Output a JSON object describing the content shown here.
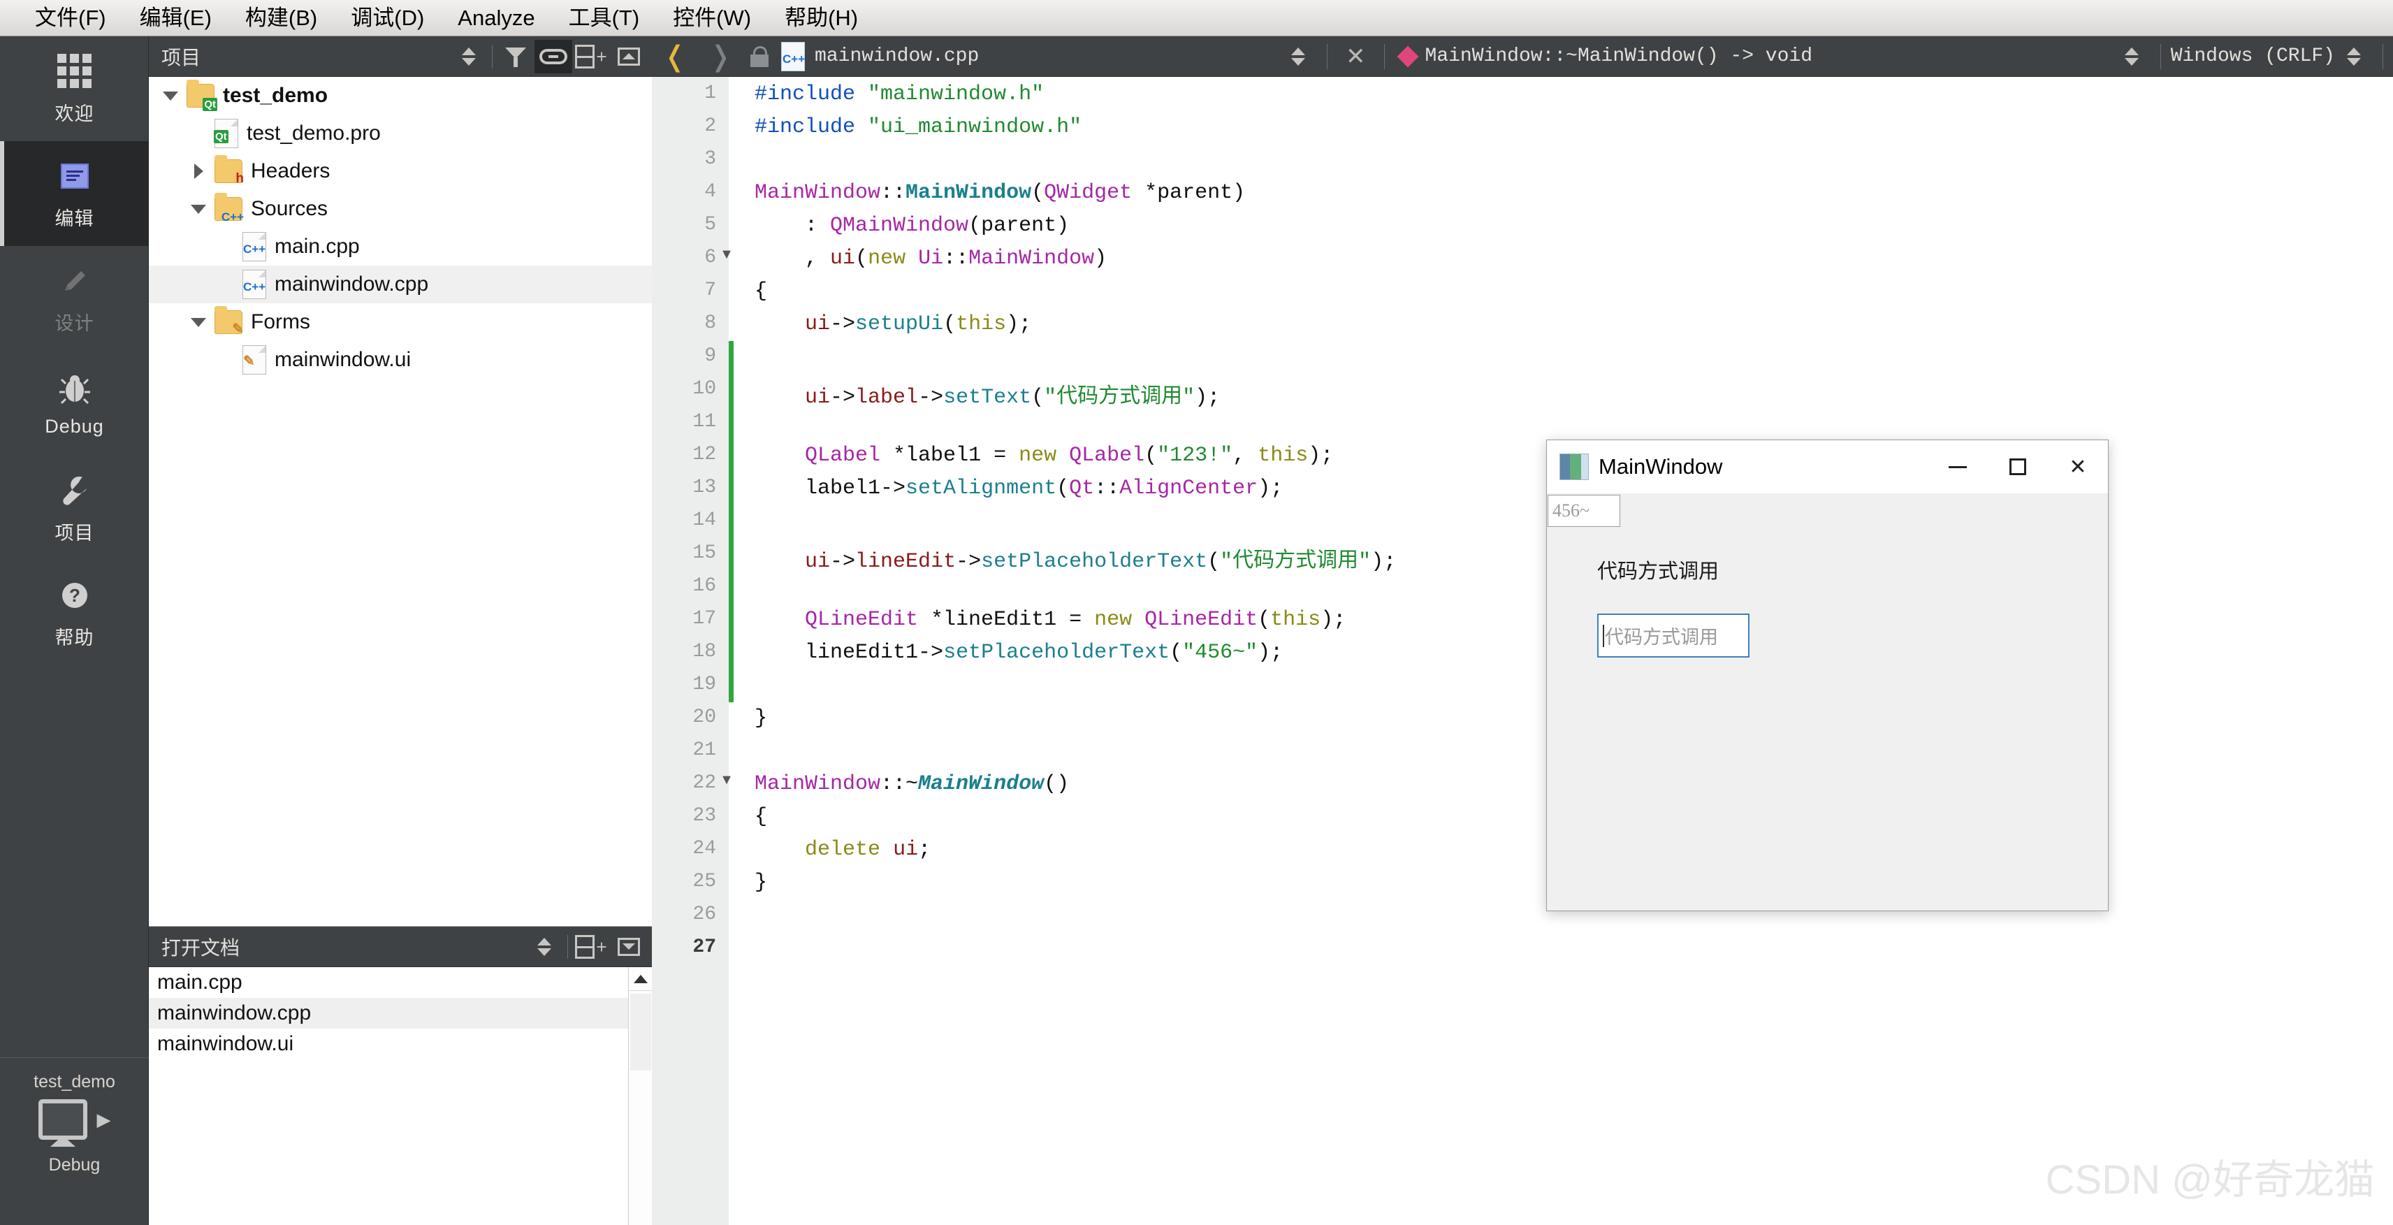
{
  "menubar": {
    "items": [
      {
        "label": "文件(F)",
        "mnemonic": "F"
      },
      {
        "label": "编辑(E)",
        "mnemonic": "E"
      },
      {
        "label": "构建(B)",
        "mnemonic": "B"
      },
      {
        "label": "调试(D)",
        "mnemonic": "D"
      },
      {
        "label": "Analyze",
        "mnemonic": "A"
      },
      {
        "label": "工具(T)",
        "mnemonic": "T"
      },
      {
        "label": "控件(W)",
        "mnemonic": "W"
      },
      {
        "label": "帮助(H)",
        "mnemonic": "H"
      }
    ]
  },
  "modebar": {
    "items": [
      {
        "label": "欢迎",
        "icon": "grid-icon",
        "state": "normal"
      },
      {
        "label": "编辑",
        "icon": "document-icon",
        "state": "active"
      },
      {
        "label": "设计",
        "icon": "pencil-icon",
        "state": "disabled"
      },
      {
        "label": "Debug",
        "icon": "bug-icon",
        "state": "normal"
      },
      {
        "label": "项目",
        "icon": "wrench-icon",
        "state": "normal"
      },
      {
        "label": "帮助",
        "icon": "question-circle-icon",
        "state": "normal"
      }
    ],
    "kit": {
      "project": "test_demo",
      "build_config": "Debug",
      "icon": "desktop-icon",
      "arrow": "▶"
    }
  },
  "sidebar": {
    "projects_panel": {
      "title": "项目",
      "buttons": [
        {
          "name": "filter-icon",
          "active": false
        },
        {
          "name": "link-icon",
          "active": true
        },
        {
          "name": "split-add-icon",
          "active": false
        },
        {
          "name": "close-panel-icon",
          "active": false
        }
      ],
      "tree": [
        {
          "label": "test_demo",
          "indent": 0,
          "twist": "open",
          "icon": "folder-qt-icon",
          "bold": true,
          "selected": false
        },
        {
          "label": "test_demo.pro",
          "indent": 1,
          "twist": "none",
          "icon": "file-qt-icon",
          "bold": false,
          "selected": false
        },
        {
          "label": "Headers",
          "indent": 1,
          "twist": "closed",
          "icon": "folder-h-icon",
          "bold": false,
          "selected": false
        },
        {
          "label": "Sources",
          "indent": 1,
          "twist": "open",
          "icon": "folder-cpp-icon",
          "bold": false,
          "selected": false
        },
        {
          "label": "main.cpp",
          "indent": 2,
          "twist": "none",
          "icon": "file-cpp-icon",
          "bold": false,
          "selected": false
        },
        {
          "label": "mainwindow.cpp",
          "indent": 2,
          "twist": "none",
          "icon": "file-cpp-icon",
          "bold": false,
          "selected": true
        },
        {
          "label": "Forms",
          "indent": 1,
          "twist": "open",
          "icon": "folder-ui-icon",
          "bold": false,
          "selected": false
        },
        {
          "label": "mainwindow.ui",
          "indent": 2,
          "twist": "none",
          "icon": "file-ui-icon",
          "bold": false,
          "selected": false
        }
      ]
    },
    "open_documents_panel": {
      "title": "打开文档",
      "buttons": [
        {
          "name": "split-add-icon",
          "active": false
        },
        {
          "name": "close-panel-icon",
          "active": false
        }
      ],
      "items": [
        {
          "label": "main.cpp",
          "selected": false
        },
        {
          "label": "mainwindow.cpp",
          "selected": true
        },
        {
          "label": "mainwindow.ui",
          "selected": false
        }
      ]
    }
  },
  "editor_toolbar": {
    "back_arrow": "❬",
    "forward_arrow": "❭",
    "lock_icon": "unlocked-icon",
    "file_icon": "cpp-file-icon",
    "filename": "mainwindow.cpp",
    "symbol": "MainWindow::~MainWindow() -> void",
    "symbol_icon": "pink-diamond-icon",
    "close_label": "✕",
    "line_ending": "Windows (CRLF)"
  },
  "editor": {
    "current_line": 27,
    "change_bar": {
      "from_line": 9,
      "to_line": 19,
      "color": "#2fa83f"
    },
    "lines": [
      {
        "n": 1,
        "fold": "",
        "tokens": [
          {
            "t": "#include ",
            "c": "k-pre"
          },
          {
            "t": "\"mainwindow.h\"",
            "c": "k-str"
          }
        ]
      },
      {
        "n": 2,
        "fold": "",
        "tokens": [
          {
            "t": "#include ",
            "c": "k-pre"
          },
          {
            "t": "\"ui_mainwindow.h\"",
            "c": "k-str"
          }
        ]
      },
      {
        "n": 3,
        "fold": "",
        "tokens": []
      },
      {
        "n": 4,
        "fold": "",
        "tokens": [
          {
            "t": "MainWindow",
            "c": "k-cls"
          },
          {
            "t": "::",
            "c": "k-plain"
          },
          {
            "t": "MainWindow",
            "c": "k-fndef"
          },
          {
            "t": "(",
            "c": "k-plain"
          },
          {
            "t": "QWidget",
            "c": "k-cls"
          },
          {
            "t": " *parent)",
            "c": "k-plain"
          }
        ]
      },
      {
        "n": 5,
        "fold": "",
        "tokens": [
          {
            "t": "    : ",
            "c": "k-plain"
          },
          {
            "t": "QMainWindow",
            "c": "k-cls"
          },
          {
            "t": "(parent)",
            "c": "k-plain"
          }
        ]
      },
      {
        "n": 6,
        "fold": "▼",
        "tokens": [
          {
            "t": "    , ",
            "c": "k-plain"
          },
          {
            "t": "ui",
            "c": "k-var"
          },
          {
            "t": "(",
            "c": "k-plain"
          },
          {
            "t": "new",
            "c": "k-kw"
          },
          {
            "t": " ",
            "c": "k-plain"
          },
          {
            "t": "Ui",
            "c": "k-cls"
          },
          {
            "t": "::",
            "c": "k-plain"
          },
          {
            "t": "MainWindow",
            "c": "k-cls"
          },
          {
            "t": ")",
            "c": "k-plain"
          }
        ]
      },
      {
        "n": 7,
        "fold": "",
        "tokens": [
          {
            "t": "{",
            "c": "k-plain"
          }
        ]
      },
      {
        "n": 8,
        "fold": "",
        "tokens": [
          {
            "t": "    ",
            "c": "k-plain"
          },
          {
            "t": "ui",
            "c": "k-var"
          },
          {
            "t": "->",
            "c": "k-plain"
          },
          {
            "t": "setupUi",
            "c": "k-fn"
          },
          {
            "t": "(",
            "c": "k-plain"
          },
          {
            "t": "this",
            "c": "k-kw"
          },
          {
            "t": ");",
            "c": "k-plain"
          }
        ]
      },
      {
        "n": 9,
        "fold": "",
        "tokens": []
      },
      {
        "n": 10,
        "fold": "",
        "tokens": [
          {
            "t": "    ",
            "c": "k-plain"
          },
          {
            "t": "ui",
            "c": "k-var"
          },
          {
            "t": "->",
            "c": "k-plain"
          },
          {
            "t": "label",
            "c": "k-var"
          },
          {
            "t": "->",
            "c": "k-plain"
          },
          {
            "t": "setText",
            "c": "k-fn"
          },
          {
            "t": "(",
            "c": "k-plain"
          },
          {
            "t": "\"代码方式调用\"",
            "c": "k-str"
          },
          {
            "t": ");",
            "c": "k-plain"
          }
        ]
      },
      {
        "n": 11,
        "fold": "",
        "tokens": []
      },
      {
        "n": 12,
        "fold": "",
        "tokens": [
          {
            "t": "    ",
            "c": "k-plain"
          },
          {
            "t": "QLabel",
            "c": "k-cls"
          },
          {
            "t": " *label1 = ",
            "c": "k-plain"
          },
          {
            "t": "new",
            "c": "k-kw"
          },
          {
            "t": " ",
            "c": "k-plain"
          },
          {
            "t": "QLabel",
            "c": "k-cls"
          },
          {
            "t": "(",
            "c": "k-plain"
          },
          {
            "t": "\"123!\"",
            "c": "k-str"
          },
          {
            "t": ", ",
            "c": "k-plain"
          },
          {
            "t": "this",
            "c": "k-kw"
          },
          {
            "t": ");",
            "c": "k-plain"
          }
        ]
      },
      {
        "n": 13,
        "fold": "",
        "tokens": [
          {
            "t": "    label1",
            "c": "k-plain"
          },
          {
            "t": "->",
            "c": "k-plain"
          },
          {
            "t": "setAlignment",
            "c": "k-fn"
          },
          {
            "t": "(",
            "c": "k-plain"
          },
          {
            "t": "Qt",
            "c": "k-cls"
          },
          {
            "t": "::",
            "c": "k-plain"
          },
          {
            "t": "AlignCenter",
            "c": "k-cls"
          },
          {
            "t": ");",
            "c": "k-plain"
          }
        ]
      },
      {
        "n": 14,
        "fold": "",
        "tokens": []
      },
      {
        "n": 15,
        "fold": "",
        "tokens": [
          {
            "t": "    ",
            "c": "k-plain"
          },
          {
            "t": "ui",
            "c": "k-var"
          },
          {
            "t": "->",
            "c": "k-plain"
          },
          {
            "t": "lineEdit",
            "c": "k-var"
          },
          {
            "t": "->",
            "c": "k-plain"
          },
          {
            "t": "setPlaceholderText",
            "c": "k-fn"
          },
          {
            "t": "(",
            "c": "k-plain"
          },
          {
            "t": "\"代码方式调用\"",
            "c": "k-str"
          },
          {
            "t": ");",
            "c": "k-plain"
          }
        ]
      },
      {
        "n": 16,
        "fold": "",
        "tokens": []
      },
      {
        "n": 17,
        "fold": "",
        "tokens": [
          {
            "t": "    ",
            "c": "k-plain"
          },
          {
            "t": "QLineEdit",
            "c": "k-cls"
          },
          {
            "t": " *lineEdit1 = ",
            "c": "k-plain"
          },
          {
            "t": "new",
            "c": "k-kw"
          },
          {
            "t": " ",
            "c": "k-plain"
          },
          {
            "t": "QLineEdit",
            "c": "k-cls"
          },
          {
            "t": "(",
            "c": "k-plain"
          },
          {
            "t": "this",
            "c": "k-kw"
          },
          {
            "t": ");",
            "c": "k-plain"
          }
        ]
      },
      {
        "n": 18,
        "fold": "",
        "tokens": [
          {
            "t": "    lineEdit1",
            "c": "k-plain"
          },
          {
            "t": "->",
            "c": "k-plain"
          },
          {
            "t": "setPlaceholderText",
            "c": "k-fn"
          },
          {
            "t": "(",
            "c": "k-plain"
          },
          {
            "t": "\"456~\"",
            "c": "k-str"
          },
          {
            "t": ");",
            "c": "k-plain"
          }
        ]
      },
      {
        "n": 19,
        "fold": "",
        "tokens": []
      },
      {
        "n": 20,
        "fold": "",
        "tokens": [
          {
            "t": "}",
            "c": "k-plain"
          }
        ]
      },
      {
        "n": 21,
        "fold": "",
        "tokens": []
      },
      {
        "n": 22,
        "fold": "▼",
        "tokens": [
          {
            "t": "MainWindow",
            "c": "k-cls"
          },
          {
            "t": "::~",
            "c": "k-plain"
          },
          {
            "t": "MainWindow",
            "c": "k-fndefi"
          },
          {
            "t": "()",
            "c": "k-plain"
          }
        ]
      },
      {
        "n": 23,
        "fold": "",
        "tokens": [
          {
            "t": "{",
            "c": "k-plain"
          }
        ]
      },
      {
        "n": 24,
        "fold": "",
        "tokens": [
          {
            "t": "    ",
            "c": "k-plain"
          },
          {
            "t": "delete",
            "c": "k-kw"
          },
          {
            "t": " ",
            "c": "k-plain"
          },
          {
            "t": "ui",
            "c": "k-var"
          },
          {
            "t": ";",
            "c": "k-plain"
          }
        ]
      },
      {
        "n": 25,
        "fold": "",
        "tokens": [
          {
            "t": "}",
            "c": "k-plain"
          }
        ]
      },
      {
        "n": 26,
        "fold": "",
        "tokens": []
      },
      {
        "n": 27,
        "fold": "",
        "tokens": []
      }
    ]
  },
  "app_window": {
    "title": "MainWindow",
    "icon": "qt-app-icon",
    "minimize_label": "—",
    "maximize_label": "☐",
    "close_label": "✕",
    "mini_line_edit_placeholder": "456~",
    "label_text": "代码方式调用",
    "line_edit_placeholder": "代码方式调用",
    "line_edit_focus_color": "#3f7fbf"
  },
  "watermark": {
    "text": "CSDN @好奇龙猫"
  }
}
